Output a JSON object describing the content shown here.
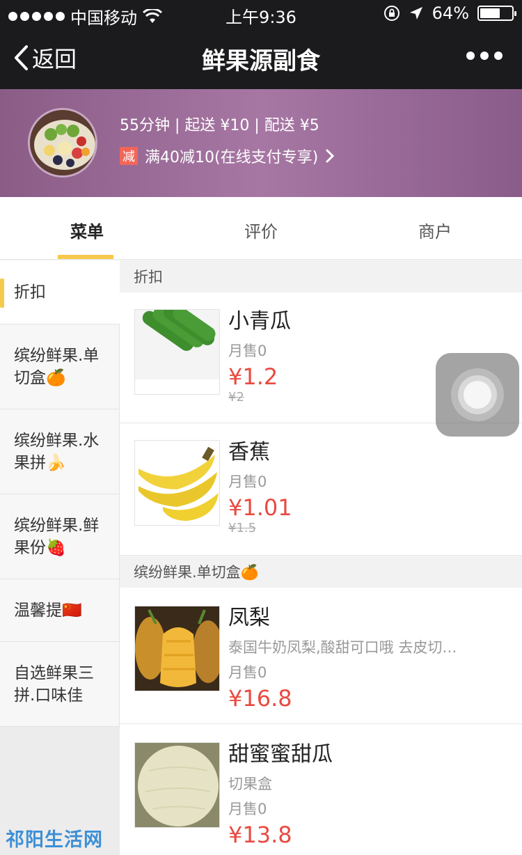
{
  "status_bar": {
    "carrier": "中国移动",
    "time": "上午9:36",
    "battery": "64%",
    "battery_level": 0.64
  },
  "nav": {
    "back_label": "返回",
    "title": "鲜果源副食"
  },
  "shop": {
    "meta": "55分钟 | 起送 ¥10 | 配送 ¥5",
    "promo_badge": "减",
    "promo_text": "满40减10(在线支付专享)"
  },
  "tabs": [
    {
      "label": "菜单",
      "active": true
    },
    {
      "label": "评价",
      "active": false
    },
    {
      "label": "商户",
      "active": false
    }
  ],
  "sidebar": {
    "categories": [
      {
        "label": "折扣",
        "active": true
      },
      {
        "label": "缤纷鲜果.单切盒🍊"
      },
      {
        "label": "缤纷鲜果.水果拼🍌"
      },
      {
        "label": "缤纷鲜果.鲜果份🍓"
      },
      {
        "label": "温馨提🇨🇳"
      },
      {
        "label": "自选鲜果三拼.口味佳"
      }
    ]
  },
  "sections": [
    {
      "title": "折扣",
      "items": [
        {
          "name": "小青瓜",
          "sales": "月售0",
          "price": "¥1.2",
          "old_price": "¥2"
        },
        {
          "name": "香蕉",
          "sales": "月售0",
          "price": "¥1.01",
          "old_price": "¥1.5"
        }
      ]
    },
    {
      "title": "缤纷鲜果.单切盒🍊",
      "items": [
        {
          "name": "凤梨",
          "desc": "泰国牛奶凤梨,酸甜可口哦  去皮切…",
          "sales": "月售0",
          "price": "¥16.8"
        },
        {
          "name": "甜蜜蜜甜瓜",
          "desc": "切果盒",
          "sales": "月售0",
          "price": "¥13.8"
        }
      ]
    }
  ],
  "watermark": "祁阳生活网"
}
